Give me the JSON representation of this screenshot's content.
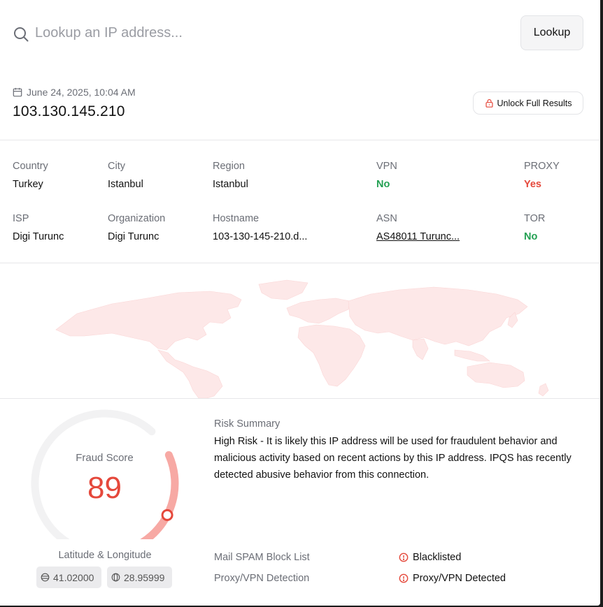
{
  "search": {
    "placeholder": "Lookup an IP address...",
    "value": "",
    "button_label": "Lookup",
    "icon": "search-icon"
  },
  "header": {
    "date": "June 24, 2025, 10:04 AM",
    "date_icon": "calendar-icon",
    "ip": "103.130.145.210",
    "unlock_label": "Unlock Full Results",
    "unlock_icon": "lock-icon"
  },
  "details": {
    "country": {
      "label": "Country",
      "value": "Turkey"
    },
    "city": {
      "label": "City",
      "value": "Istanbul"
    },
    "region": {
      "label": "Region",
      "value": "Istanbul"
    },
    "vpn": {
      "label": "VPN",
      "value": "No"
    },
    "proxy": {
      "label": "PROXY",
      "value": "Yes"
    },
    "isp": {
      "label": "ISP",
      "value": "Digi Turunc"
    },
    "organization": {
      "label": "Organization",
      "value": "Digi Turunc"
    },
    "hostname": {
      "label": "Hostname",
      "value": "103-130-145-210.d..."
    },
    "asn": {
      "label": "ASN",
      "value": "AS48011 Turunc..."
    },
    "tor": {
      "label": "TOR",
      "value": "No"
    }
  },
  "colors": {
    "positive": "#22a052",
    "negative": "#e5483b",
    "map_fill": "#fde8e8"
  },
  "fraud": {
    "label": "Fraud Score",
    "score": "89",
    "score_value": 89
  },
  "location": {
    "label": "Latitude & Longitude",
    "latitude": "41.02000",
    "longitude": "28.95999"
  },
  "risk": {
    "title": "Risk Summary",
    "text": "High Risk - It is likely this IP address will be used for fraudulent behavior and malicious activity based on recent actions by this IP address. IPQS has recently detected abusive behavior from this connection.",
    "rows": [
      {
        "label": "Mail SPAM Block List",
        "value": "Blacklisted",
        "icon": "alert-circle-icon"
      },
      {
        "label": "Proxy/VPN Detection",
        "value": "Proxy/VPN Detected",
        "icon": "alert-circle-icon"
      }
    ]
  }
}
